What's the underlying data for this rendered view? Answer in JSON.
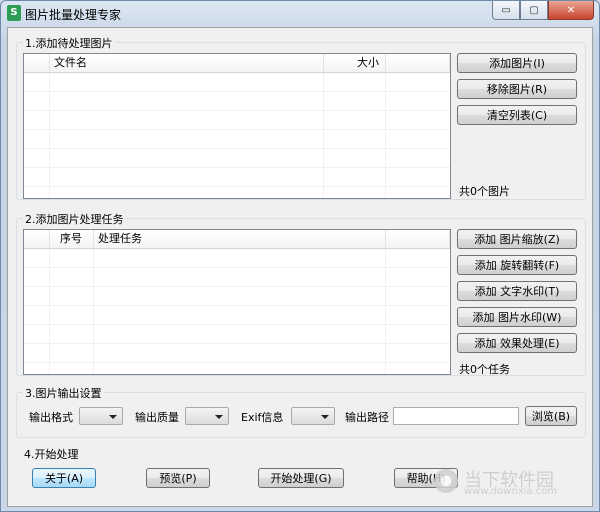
{
  "window": {
    "title": "图片批量处理专家",
    "icon_glyph": "S"
  },
  "window_controls": {
    "minimize": "▭",
    "maximize": "▢",
    "close": "✕"
  },
  "section1": {
    "title": "1.添加待处理图片",
    "columns": [
      "文件名",
      "大小"
    ],
    "buttons": {
      "add": "添加图片(I)",
      "remove": "移除图片(R)",
      "clear": "清空列表(C)"
    },
    "count_text": "共0个图片"
  },
  "section2": {
    "title": "2.添加图片处理任务",
    "columns": [
      "序号",
      "处理任务"
    ],
    "buttons": {
      "zoom": "添加 图片缩放(Z)",
      "rotate": "添加 旋转翻转(F)",
      "text_watermark": "添加 文字水印(T)",
      "image_watermark": "添加 图片水印(W)",
      "effect": "添加 效果处理(E)"
    },
    "count_text": "共0个任务"
  },
  "section3": {
    "title": "3.图片输出设置",
    "format_label": "输出格式",
    "quality_label": "输出质量",
    "exif_label": "Exif信息",
    "path_label": "输出路径",
    "browse_button": "浏览(B)"
  },
  "section4": {
    "title": "4.开始处理",
    "about_button": "关于(A)",
    "preview_button": "预览(P)",
    "start_button": "开始处理(G)",
    "help_button": "帮助(H)"
  },
  "watermark": {
    "text": "当下软件园",
    "url": "www.downxia.com"
  }
}
